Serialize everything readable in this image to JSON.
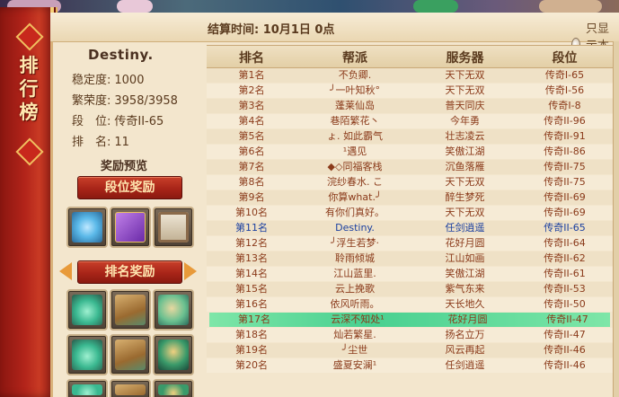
{
  "window": {
    "title_chars": [
      "排",
      "行",
      "榜"
    ]
  },
  "header": {
    "settle_label": "结算时间: 10月1日 0点",
    "toggle_label": "只显示本服",
    "toggle_checked": false
  },
  "profile": {
    "name": "Destiny.",
    "stats": [
      {
        "key": "稳定度:",
        "value": "1000"
      },
      {
        "key": "繁荣度:",
        "value": "3958/3958"
      },
      {
        "key": "段　位:",
        "value": "传奇II-65"
      },
      {
        "key": "排　名:",
        "value": "11"
      }
    ],
    "reward_preview_title": "奖励预览",
    "tier_reward_button": "段位奖励",
    "rank_reward_button": "排名奖励"
  },
  "reward_slots_tier": [
    "dragon-icon",
    "book-icon",
    "scroll-icon"
  ],
  "reward_slots_rank": [
    "jade-ornament-icon",
    "wooden-bridge-icon",
    "garden-island-icon",
    "jade-ornament-icon",
    "wooden-bridge-icon",
    "tree-pavilion-icon",
    "jade-fragment-icon",
    "bridge-fragment-icon",
    "tree-fragment-icon"
  ],
  "table": {
    "headers": [
      "排名",
      "帮派",
      "服务器",
      "段位"
    ],
    "rows": [
      {
        "rank": "第1名",
        "guild": "不负卿.",
        "server": "天下无双",
        "tier": "传奇I-65"
      },
      {
        "rank": "第2名",
        "guild": "╯一叶知秋°",
        "server": "天下无双",
        "tier": "传奇I-56"
      },
      {
        "rank": "第3名",
        "guild": "蓬莱仙岛",
        "server": "普天同庆",
        "tier": "传奇I-8"
      },
      {
        "rank": "第4名",
        "guild": "巷陌繁花丶",
        "server": "今年勇",
        "tier": "传奇II-96"
      },
      {
        "rank": "第5名",
        "guild": "ょ. 如此霸气",
        "server": "壮志凌云",
        "tier": "传奇II-91"
      },
      {
        "rank": "第6名",
        "guild": "¹遇见",
        "server": "笑傲江湖",
        "tier": "传奇II-86"
      },
      {
        "rank": "第7名",
        "guild": "◆◇同福客栈",
        "server": "沉鱼落雁",
        "tier": "传奇II-75"
      },
      {
        "rank": "第8名",
        "guild": "浣纱春水. こ",
        "server": "天下无双",
        "tier": "传奇II-75"
      },
      {
        "rank": "第9名",
        "guild": "你算what.╯",
        "server": "醉生梦死",
        "tier": "传奇II-69"
      },
      {
        "rank": "第10名",
        "guild": "有你们真好。",
        "server": "天下无双",
        "tier": "传奇II-69"
      },
      {
        "rank": "第11名",
        "guild": "Destiny.",
        "server": "任剑逍遥",
        "tier": "传奇II-65",
        "me": true
      },
      {
        "rank": "第12名",
        "guild": "╯浮生若梦·",
        "server": "花好月圆",
        "tier": "传奇II-64"
      },
      {
        "rank": "第13名",
        "guild": "聆雨倾城",
        "server": "江山如画",
        "tier": "传奇II-62"
      },
      {
        "rank": "第14名",
        "guild": "江山蓝里.",
        "server": "笑傲江湖",
        "tier": "传奇II-61"
      },
      {
        "rank": "第15名",
        "guild": "云上挽歌",
        "server": "紫气东来",
        "tier": "传奇II-53"
      },
      {
        "rank": "第16名",
        "guild": "依风听雨。",
        "server": "天长地久",
        "tier": "传奇II-50"
      },
      {
        "rank": "第17名",
        "guild": "云深不知处¹",
        "server": "花好月圆",
        "tier": "传奇II-47",
        "highlight": true
      },
      {
        "rank": "第18名",
        "guild": "灿若繁星.",
        "server": "扬名立万",
        "tier": "传奇II-47"
      },
      {
        "rank": "第19名",
        "guild": "╯尘世",
        "server": "风云再起",
        "tier": "传奇II-46"
      },
      {
        "rank": "第20名",
        "guild": "盛夏安澜¹",
        "server": "任剑逍遥",
        "tier": "传奇II-46"
      }
    ]
  },
  "colors": {
    "panel_bg": "#f3e6cd",
    "row_text": "#8a3a1a",
    "self_row_text": "#1a3fa0",
    "highlight_row": "#48d090",
    "accent_red": "#a82418"
  }
}
